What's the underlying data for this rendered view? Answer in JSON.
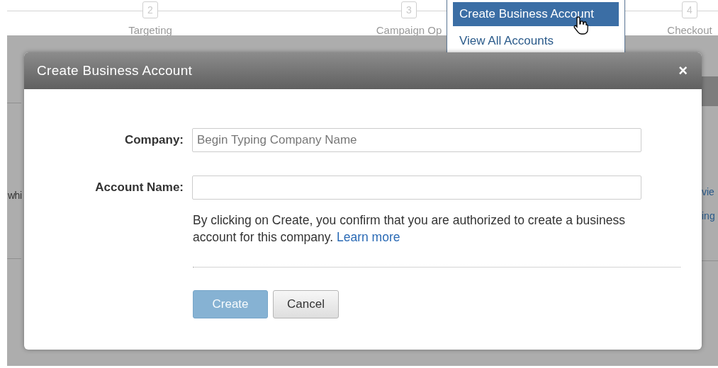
{
  "steps": [
    {
      "number": "2",
      "label": "Targeting"
    },
    {
      "number": "3",
      "label": "Campaign Op"
    },
    {
      "number": "4",
      "label": "Checkout"
    }
  ],
  "background_fragments": [
    {
      "text": "whi",
      "kind": "plain"
    },
    {
      "text": "vie",
      "kind": "link"
    },
    {
      "text": "ing",
      "kind": "link"
    }
  ],
  "account_menu": {
    "items": [
      {
        "label": "Create Business Account",
        "selected": true
      },
      {
        "label": "View All Accounts",
        "selected": false
      }
    ]
  },
  "dialog": {
    "title": "Create Business Account",
    "close": "×",
    "fields": [
      {
        "label": "Company:",
        "placeholder": "Begin Typing Company Name"
      },
      {
        "label": "Account Name:"
      }
    ],
    "notice": "By clicking on Create, you confirm that you are authorized to create a business account for this company.",
    "notice_link": "Learn more",
    "buttons": [
      {
        "label": "Create",
        "kind": "primary",
        "disabled": true
      },
      {
        "label": "Cancel",
        "kind": "secondary",
        "disabled": false
      }
    ]
  }
}
